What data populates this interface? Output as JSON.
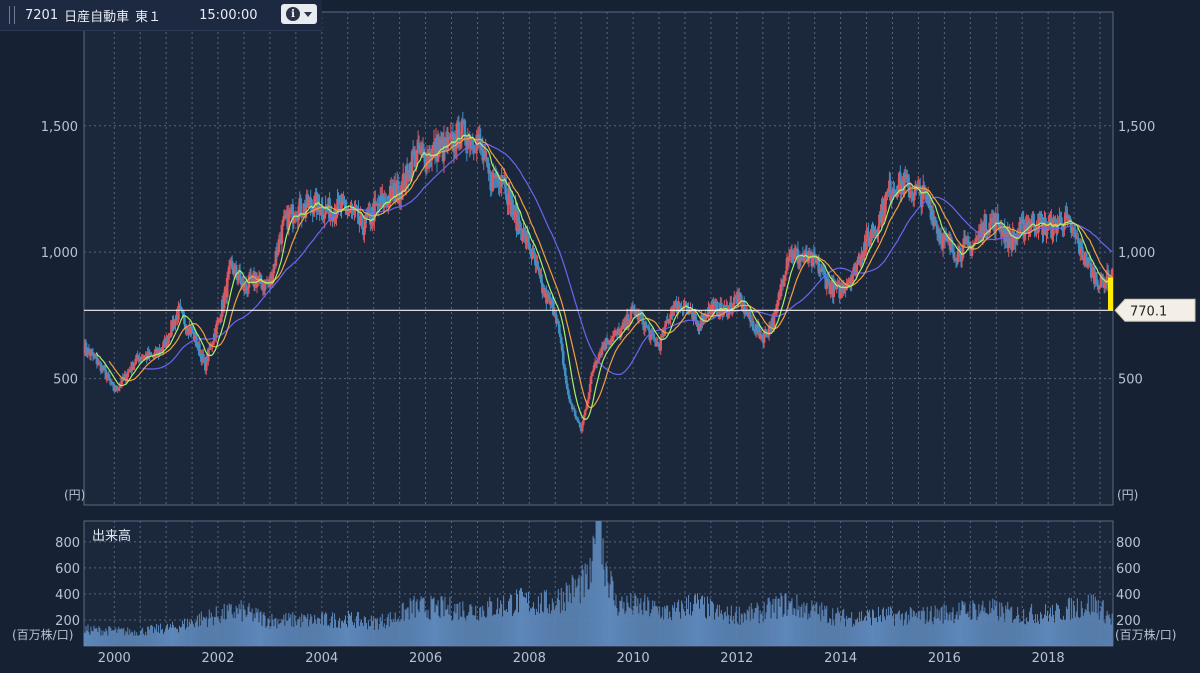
{
  "header": {
    "code": "7201",
    "name": "日産自動車",
    "market": "東１",
    "time": "15:00:00",
    "info_icon": "info-icon",
    "dropdown_icon": "chevron-down-icon"
  },
  "colors": {
    "background": "#162133",
    "panel": "#1b273b",
    "grid": "#55657e",
    "axis_text": "#b7c2d2",
    "up": "#e0565e",
    "down": "#3f8fc4",
    "ma_short": "#a8f26a",
    "ma_mid": "#f3a040",
    "ma_long": "#6a66f0",
    "volume": "#5e88ba",
    "current_line": "#f5f5f5",
    "current_marker": "#ffee00"
  },
  "price_panel": {
    "unit_label": "(円)",
    "current_price": "770.1"
  },
  "volume_panel": {
    "title": "出来高",
    "unit_label": "(百万株/口)"
  },
  "chart_data": {
    "type": "candlestick",
    "x_ticks": [
      "2000",
      "2002",
      "2004",
      "2006",
      "2008",
      "2010",
      "2012",
      "2014",
      "2016",
      "2018"
    ],
    "x_range": [
      "1999-06",
      "2019-04"
    ],
    "price": {
      "y_ticks": [
        "500",
        "1,000",
        "1,500"
      ],
      "ylim": [
        0,
        1950
      ],
      "current": 770.1,
      "close": [
        [
          "1999-06",
          640
        ],
        [
          "1999-09",
          560
        ],
        [
          "2000-01",
          460
        ],
        [
          "2000-04",
          520
        ],
        [
          "2000-07",
          580
        ],
        [
          "2000-10",
          600
        ],
        [
          "2001-01",
          640
        ],
        [
          "2001-04",
          760
        ],
        [
          "2001-07",
          700
        ],
        [
          "2001-10",
          540
        ],
        [
          "2002-01",
          720
        ],
        [
          "2002-04",
          960
        ],
        [
          "2002-07",
          840
        ],
        [
          "2002-10",
          900
        ],
        [
          "2003-01",
          880
        ],
        [
          "2003-04",
          1080
        ],
        [
          "2003-07",
          1200
        ],
        [
          "2003-10",
          1180
        ],
        [
          "2004-01",
          1160
        ],
        [
          "2004-04",
          1200
        ],
        [
          "2004-07",
          1150
        ],
        [
          "2004-10",
          1100
        ],
        [
          "2005-01",
          1180
        ],
        [
          "2005-04",
          1180
        ],
        [
          "2005-07",
          1260
        ],
        [
          "2005-10",
          1380
        ],
        [
          "2006-01",
          1350
        ],
        [
          "2006-04",
          1440
        ],
        [
          "2006-07",
          1420
        ],
        [
          "2006-10",
          1450
        ],
        [
          "2007-01",
          1480
        ],
        [
          "2007-04",
          1260
        ],
        [
          "2007-07",
          1300
        ],
        [
          "2007-10",
          1150
        ],
        [
          "2008-01",
          1000
        ],
        [
          "2008-04",
          860
        ],
        [
          "2008-07",
          780
        ],
        [
          "2008-10",
          420
        ],
        [
          "2009-01",
          300
        ],
        [
          "2009-04",
          560
        ],
        [
          "2009-07",
          640
        ],
        [
          "2009-10",
          700
        ],
        [
          "2010-01",
          760
        ],
        [
          "2010-04",
          700
        ],
        [
          "2010-07",
          640
        ],
        [
          "2010-10",
          760
        ],
        [
          "2011-01",
          800
        ],
        [
          "2011-04",
          720
        ],
        [
          "2011-07",
          760
        ],
        [
          "2011-10",
          780
        ],
        [
          "2012-01",
          820
        ],
        [
          "2012-04",
          720
        ],
        [
          "2012-07",
          680
        ],
        [
          "2012-10",
          740
        ],
        [
          "2013-01",
          1000
        ],
        [
          "2013-04",
          1000
        ],
        [
          "2013-07",
          940
        ],
        [
          "2013-10",
          880
        ],
        [
          "2014-01",
          860
        ],
        [
          "2014-04",
          900
        ],
        [
          "2014-07",
          1060
        ],
        [
          "2014-10",
          1140
        ],
        [
          "2015-01",
          1240
        ],
        [
          "2015-04",
          1300
        ],
        [
          "2015-07",
          1220
        ],
        [
          "2015-10",
          1160
        ],
        [
          "2016-01",
          1060
        ],
        [
          "2016-04",
          980
        ],
        [
          "2016-07",
          1020
        ],
        [
          "2016-10",
          1120
        ],
        [
          "2017-01",
          1100
        ],
        [
          "2017-04",
          1060
        ],
        [
          "2017-07",
          1100
        ],
        [
          "2017-10",
          1100
        ],
        [
          "2018-01",
          1120
        ],
        [
          "2018-04",
          1120
        ],
        [
          "2018-07",
          1060
        ],
        [
          "2018-10",
          980
        ],
        [
          "2019-01",
          860
        ],
        [
          "2019-04",
          900
        ]
      ]
    },
    "volume": {
      "y_ticks": [
        "200",
        "400",
        "600",
        "800"
      ],
      "ylim": [
        0,
        960
      ],
      "values": [
        [
          "1999-06",
          140
        ],
        [
          "2000-06",
          120
        ],
        [
          "2001-03",
          160
        ],
        [
          "2001-09",
          230
        ],
        [
          "2002-06",
          300
        ],
        [
          "2003-01",
          220
        ],
        [
          "2003-06",
          220
        ],
        [
          "2004-01",
          220
        ],
        [
          "2004-07",
          230
        ],
        [
          "2005-01",
          200
        ],
        [
          "2005-06",
          240
        ],
        [
          "2005-10",
          330
        ],
        [
          "2006-06",
          320
        ],
        [
          "2007-01",
          310
        ],
        [
          "2007-06",
          340
        ],
        [
          "2007-10",
          380
        ],
        [
          "2008-06",
          360
        ],
        [
          "2008-10",
          460
        ],
        [
          "2009-03",
          560
        ],
        [
          "2009-05",
          960
        ],
        [
          "2009-09",
          360
        ],
        [
          "2010-04",
          330
        ],
        [
          "2010-10",
          280
        ],
        [
          "2011-03",
          370
        ],
        [
          "2011-10",
          260
        ],
        [
          "2012-06",
          280
        ],
        [
          "2012-12",
          360
        ],
        [
          "2013-06",
          310
        ],
        [
          "2014-02",
          240
        ],
        [
          "2014-10",
          260
        ],
        [
          "2015-06",
          250
        ],
        [
          "2016-03",
          290
        ],
        [
          "2016-10",
          320
        ],
        [
          "2017-06",
          270
        ],
        [
          "2018-03",
          280
        ],
        [
          "2018-08",
          340
        ],
        [
          "2018-12",
          360
        ],
        [
          "2019-04",
          220
        ]
      ]
    }
  }
}
